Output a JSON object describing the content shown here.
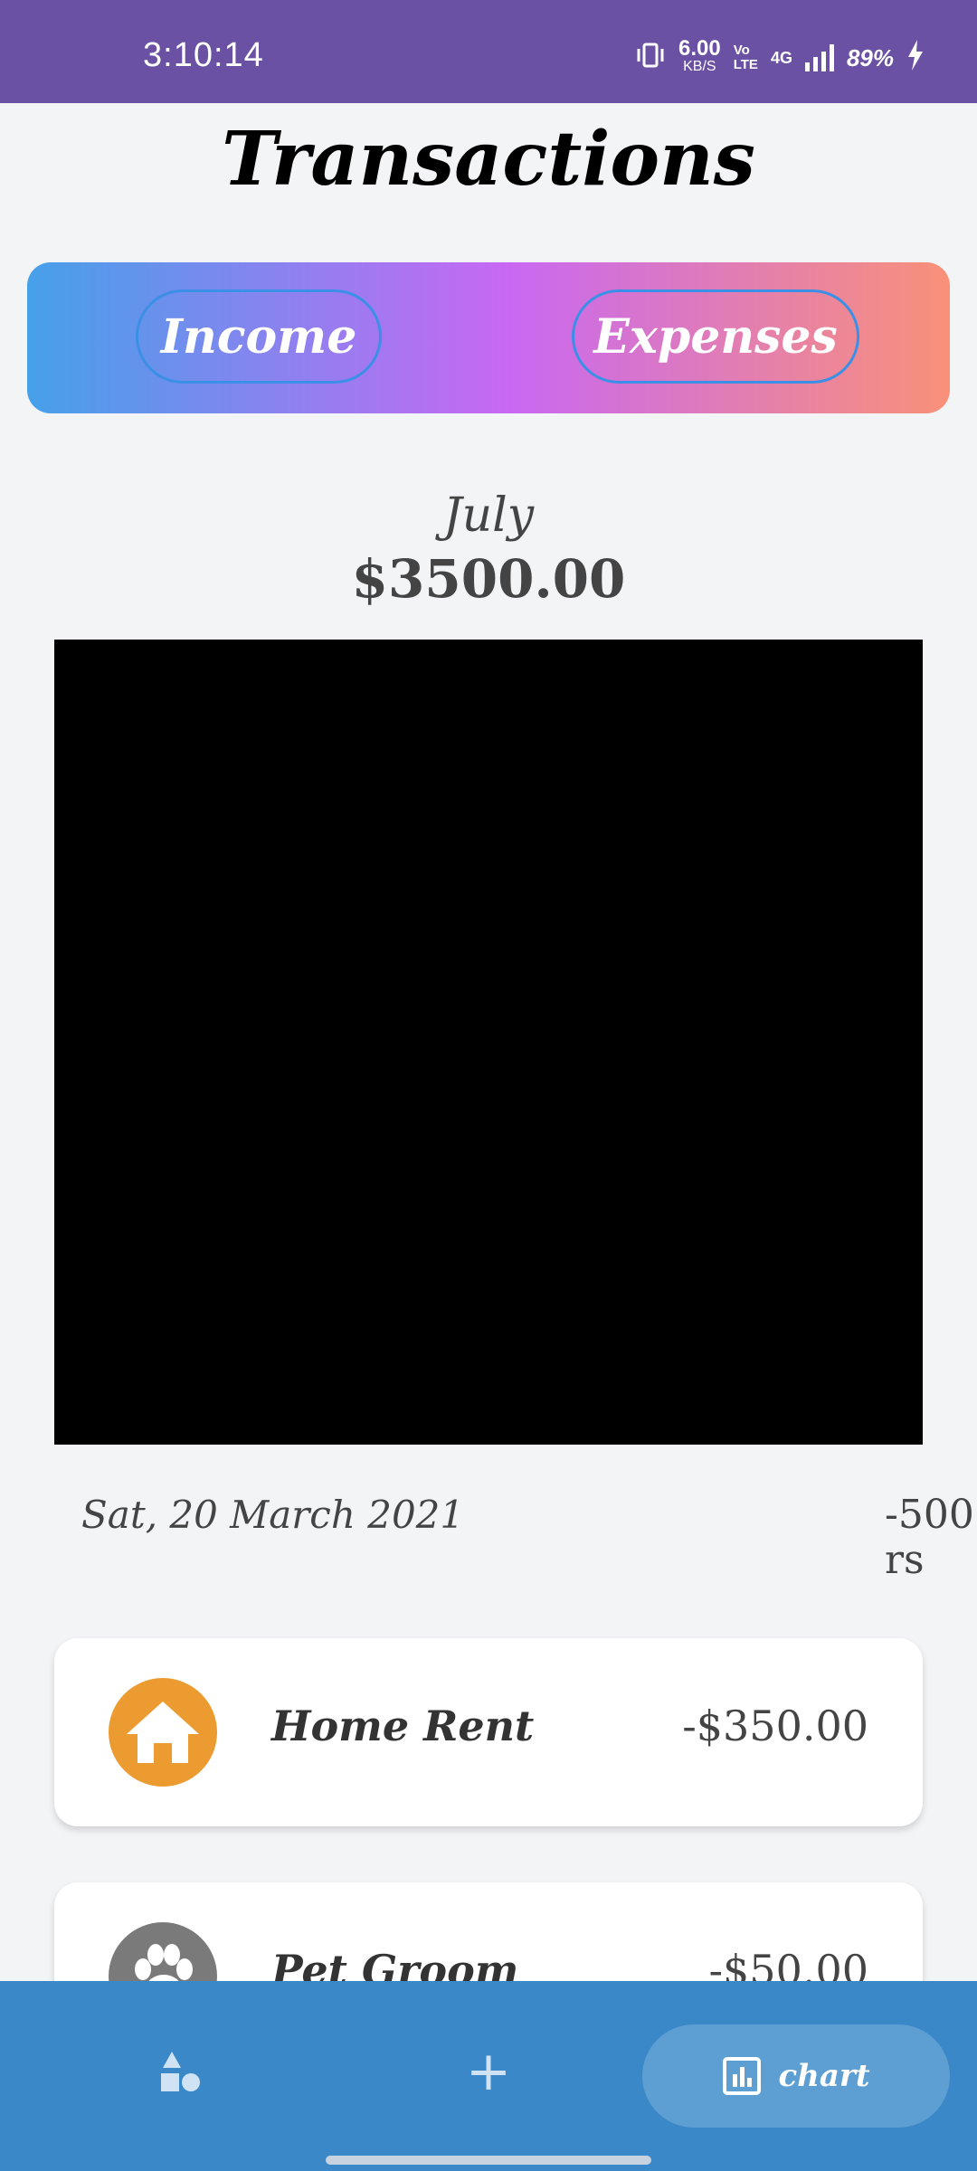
{
  "status_bar": {
    "time": "3:10:14",
    "net_speed": "6.00",
    "net_unit": "KB/S",
    "volte_top": "Vo",
    "volte_bottom": "LTE",
    "network": "4G",
    "battery": "89%"
  },
  "header": {
    "title": "Transactions"
  },
  "toggle": {
    "income_label": "Income",
    "expenses_label": "Expenses"
  },
  "summary": {
    "month": "July",
    "total": "$3500.00"
  },
  "group": {
    "date": "Sat, 20 March 2021",
    "total": "-500 rs"
  },
  "transactions": [
    {
      "name": "Home Rent",
      "amount": "-$350.00",
      "icon": "home-icon",
      "icon_color": "#ec9b30"
    },
    {
      "name": "Pet Groom",
      "amount": "-$50.00",
      "icon": "paw-icon",
      "icon_color": "#7a7a7a"
    }
  ],
  "bottom_nav": {
    "chart_label": "chart",
    "add_symbol": "+"
  },
  "colors": {
    "status_bar": "#6a51a3",
    "gradient_start": "#46a0ea",
    "gradient_mid": "#c868f3",
    "gradient_end": "#f99178",
    "bottom_nav": "#3a88c8"
  }
}
